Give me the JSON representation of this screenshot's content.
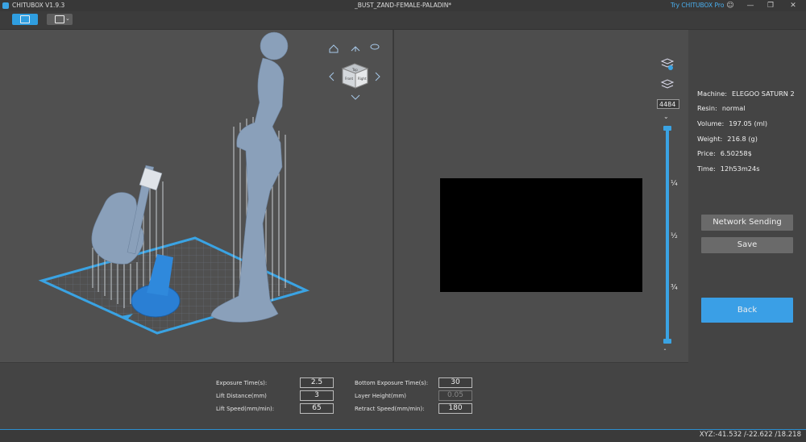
{
  "app": {
    "name": "CHITUBOX V1.9.3",
    "document": "_BUST_ZAND-FEMALE-PALADIN*",
    "pro_link": "Try CHITUBOX Pro"
  },
  "info": {
    "machine_label": "Machine:",
    "machine": "ELEGOO SATURN 2",
    "resin_label": "Resin:",
    "resin": "normal",
    "volume_label": "Volume:",
    "volume": "197.05  (ml)",
    "weight_label": "Weight:",
    "weight": "216.8  (g)",
    "price_label": "Price:",
    "price": "6.50258$",
    "time_label": "Time:",
    "time": "12h53m24s"
  },
  "buttons": {
    "network": "Network Sending",
    "save": "Save",
    "back": "Back"
  },
  "layer": {
    "value": "4484",
    "marks": [
      "¼",
      "½",
      "¾"
    ]
  },
  "params": {
    "exposure_label": "Exposure Time(s):",
    "exposure": "2.5",
    "bottom_exposure_label": "Bottom Exposure Time(s):",
    "bottom_exposure": "30",
    "lift_distance_label": "Lift Distance(mm)",
    "lift_distance": "3",
    "layer_height_label": "Layer Height(mm)",
    "layer_height": "0.05",
    "lift_speed_label": "Lift Speed(mm/min):",
    "lift_speed": "65",
    "retract_speed_label": "Retract Speed(mm/min):",
    "retract_speed": "180"
  },
  "status": {
    "xyz": "XYZ:-41.532 /-22.622 /18.218"
  },
  "viewcube": {
    "faces": [
      "Top",
      "Front",
      "Right"
    ]
  },
  "colors": {
    "accent": "#3aa3e3",
    "model": "#7f9ab8",
    "support": "#c8ccd0"
  }
}
